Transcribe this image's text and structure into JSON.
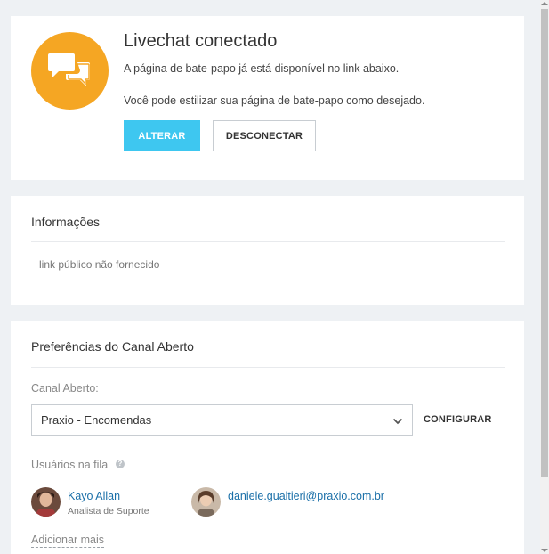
{
  "livechat": {
    "title": "Livechat conectado",
    "line1": "A página de bate-papo já está disponível no link abaixo.",
    "line2": "Você pode estilizar sua página de bate-papo como desejado.",
    "alterar_label": "ALTERAR",
    "desconectar_label": "DESCONECTAR",
    "icon": "chat-bubbles-icon"
  },
  "informacoes": {
    "title": "Informações",
    "text": "link público não fornecido"
  },
  "preferencias": {
    "title": "Preferências do Canal Aberto",
    "canal_label": "Canal Aberto:",
    "canal_selected": "Praxio - Encomendas",
    "configurar_label": "CONFIGURAR",
    "usuarios_label": "Usuários na fila",
    "help_icon_glyph": "?",
    "users": [
      {
        "name": "Kayo Allan",
        "role": "Analista de Suporte"
      },
      {
        "name": "daniele.gualtieri@praxio.com.br"
      }
    ],
    "add_more": "Adicionar mais"
  },
  "colors": {
    "accent_orange": "#f5a623",
    "button_primary": "#3ec7f0",
    "link_blue": "#1a6fa8",
    "background": "#eef1f4"
  }
}
